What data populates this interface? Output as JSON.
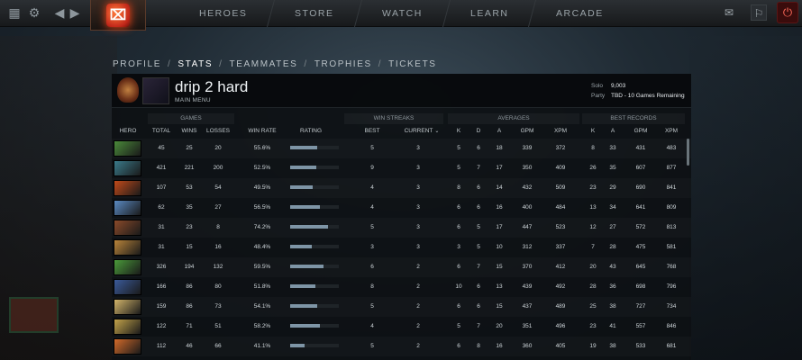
{
  "nav": {
    "items": [
      "HEROES",
      "STORE",
      "WATCH",
      "LEARN",
      "ARCADE"
    ]
  },
  "subnav": {
    "items": [
      "PROFILE",
      "STATS",
      "TEAMMATES",
      "TROPHIES",
      "TICKETS"
    ],
    "separator": "/",
    "active_index": 1
  },
  "profile": {
    "name": "drip 2 hard",
    "subtitle": "MAIN MENU",
    "solo_label": "Solo",
    "solo_value": "9,003",
    "party_label": "Party",
    "party_value": "TBD - 10 Games Remaining"
  },
  "groups": {
    "games": "GAMES",
    "win_streaks": "WIN STREAKS",
    "averages": "AVERAGES",
    "best_records": "BEST RECORDS"
  },
  "columns": {
    "hero": "HERO",
    "total": "TOTAL",
    "wins": "WINS",
    "losses": "LOSSES",
    "win_rate": "WIN RATE",
    "rating": "RATING",
    "best": "BEST",
    "current": "CURRENT",
    "avg_k": "K",
    "avg_d": "D",
    "avg_a": "A",
    "avg_gpm": "GPM",
    "avg_xpm": "XPM",
    "best_k": "K",
    "best_a": "A",
    "best_gpm": "GPM",
    "best_xpm": "XPM"
  },
  "rows": [
    {
      "hero_color": "#4a8a3a",
      "total": "45",
      "wins": "25",
      "losses": "20",
      "win_rate": "55.6%",
      "rating": 0.55,
      "best": "5",
      "current": "3",
      "k": "5",
      "d": "6",
      "a": "18",
      "gpm": "339",
      "xpm": "372",
      "bk": "8",
      "ba": "33",
      "bgpm": "431",
      "bxpm": "483"
    },
    {
      "hero_color": "#3a7a8a",
      "total": "421",
      "wins": "221",
      "losses": "200",
      "win_rate": "52.5%",
      "rating": 0.53,
      "best": "9",
      "current": "3",
      "k": "5",
      "d": "7",
      "a": "17",
      "gpm": "350",
      "xpm": "409",
      "bk": "26",
      "ba": "35",
      "bgpm": "607",
      "bxpm": "877"
    },
    {
      "hero_color": "#c24a1a",
      "total": "107",
      "wins": "53",
      "losses": "54",
      "win_rate": "49.5%",
      "rating": 0.47,
      "best": "4",
      "current": "3",
      "k": "8",
      "d": "6",
      "a": "14",
      "gpm": "432",
      "xpm": "509",
      "bk": "23",
      "ba": "29",
      "bgpm": "690",
      "bxpm": "841"
    },
    {
      "hero_color": "#5a8ac2",
      "total": "62",
      "wins": "35",
      "losses": "27",
      "win_rate": "56.5%",
      "rating": 0.62,
      "best": "4",
      "current": "3",
      "k": "6",
      "d": "6",
      "a": "16",
      "gpm": "400",
      "xpm": "484",
      "bk": "13",
      "ba": "34",
      "bgpm": "641",
      "bxpm": "809"
    },
    {
      "hero_color": "#8a4a2a",
      "total": "31",
      "wins": "23",
      "losses": "8",
      "win_rate": "74.2%",
      "rating": 0.78,
      "best": "5",
      "current": "3",
      "k": "6",
      "d": "5",
      "a": "17",
      "gpm": "447",
      "xpm": "523",
      "bk": "12",
      "ba": "27",
      "bgpm": "572",
      "bxpm": "813"
    },
    {
      "hero_color": "#b8843a",
      "total": "31",
      "wins": "15",
      "losses": "16",
      "win_rate": "48.4%",
      "rating": 0.44,
      "best": "3",
      "current": "3",
      "k": "3",
      "d": "5",
      "a": "10",
      "gpm": "312",
      "xpm": "337",
      "bk": "7",
      "ba": "28",
      "bgpm": "475",
      "bxpm": "581"
    },
    {
      "hero_color": "#4a9a3a",
      "total": "326",
      "wins": "194",
      "losses": "132",
      "win_rate": "59.5%",
      "rating": 0.68,
      "best": "6",
      "current": "2",
      "k": "6",
      "d": "7",
      "a": "15",
      "gpm": "370",
      "xpm": "412",
      "bk": "20",
      "ba": "43",
      "bgpm": "645",
      "bxpm": "768"
    },
    {
      "hero_color": "#3a5a9a",
      "total": "166",
      "wins": "86",
      "losses": "80",
      "win_rate": "51.8%",
      "rating": 0.52,
      "best": "8",
      "current": "2",
      "k": "10",
      "d": "6",
      "a": "13",
      "gpm": "439",
      "xpm": "492",
      "bk": "28",
      "ba": "36",
      "bgpm": "698",
      "bxpm": "796"
    },
    {
      "hero_color": "#d2b46a",
      "total": "159",
      "wins": "86",
      "losses": "73",
      "win_rate": "54.1%",
      "rating": 0.56,
      "best": "5",
      "current": "2",
      "k": "6",
      "d": "6",
      "a": "15",
      "gpm": "437",
      "xpm": "489",
      "bk": "25",
      "ba": "38",
      "bgpm": "727",
      "bxpm": "734"
    },
    {
      "hero_color": "#c2a24a",
      "total": "122",
      "wins": "71",
      "losses": "51",
      "win_rate": "58.2%",
      "rating": 0.62,
      "best": "4",
      "current": "2",
      "k": "5",
      "d": "7",
      "a": "20",
      "gpm": "351",
      "xpm": "496",
      "bk": "23",
      "ba": "41",
      "bgpm": "557",
      "bxpm": "846"
    },
    {
      "hero_color": "#d26a2a",
      "total": "112",
      "wins": "46",
      "losses": "66",
      "win_rate": "41.1%",
      "rating": 0.3,
      "best": "5",
      "current": "2",
      "k": "6",
      "d": "8",
      "a": "16",
      "gpm": "360",
      "xpm": "405",
      "bk": "19",
      "ba": "38",
      "bgpm": "533",
      "bxpm": "681"
    }
  ]
}
